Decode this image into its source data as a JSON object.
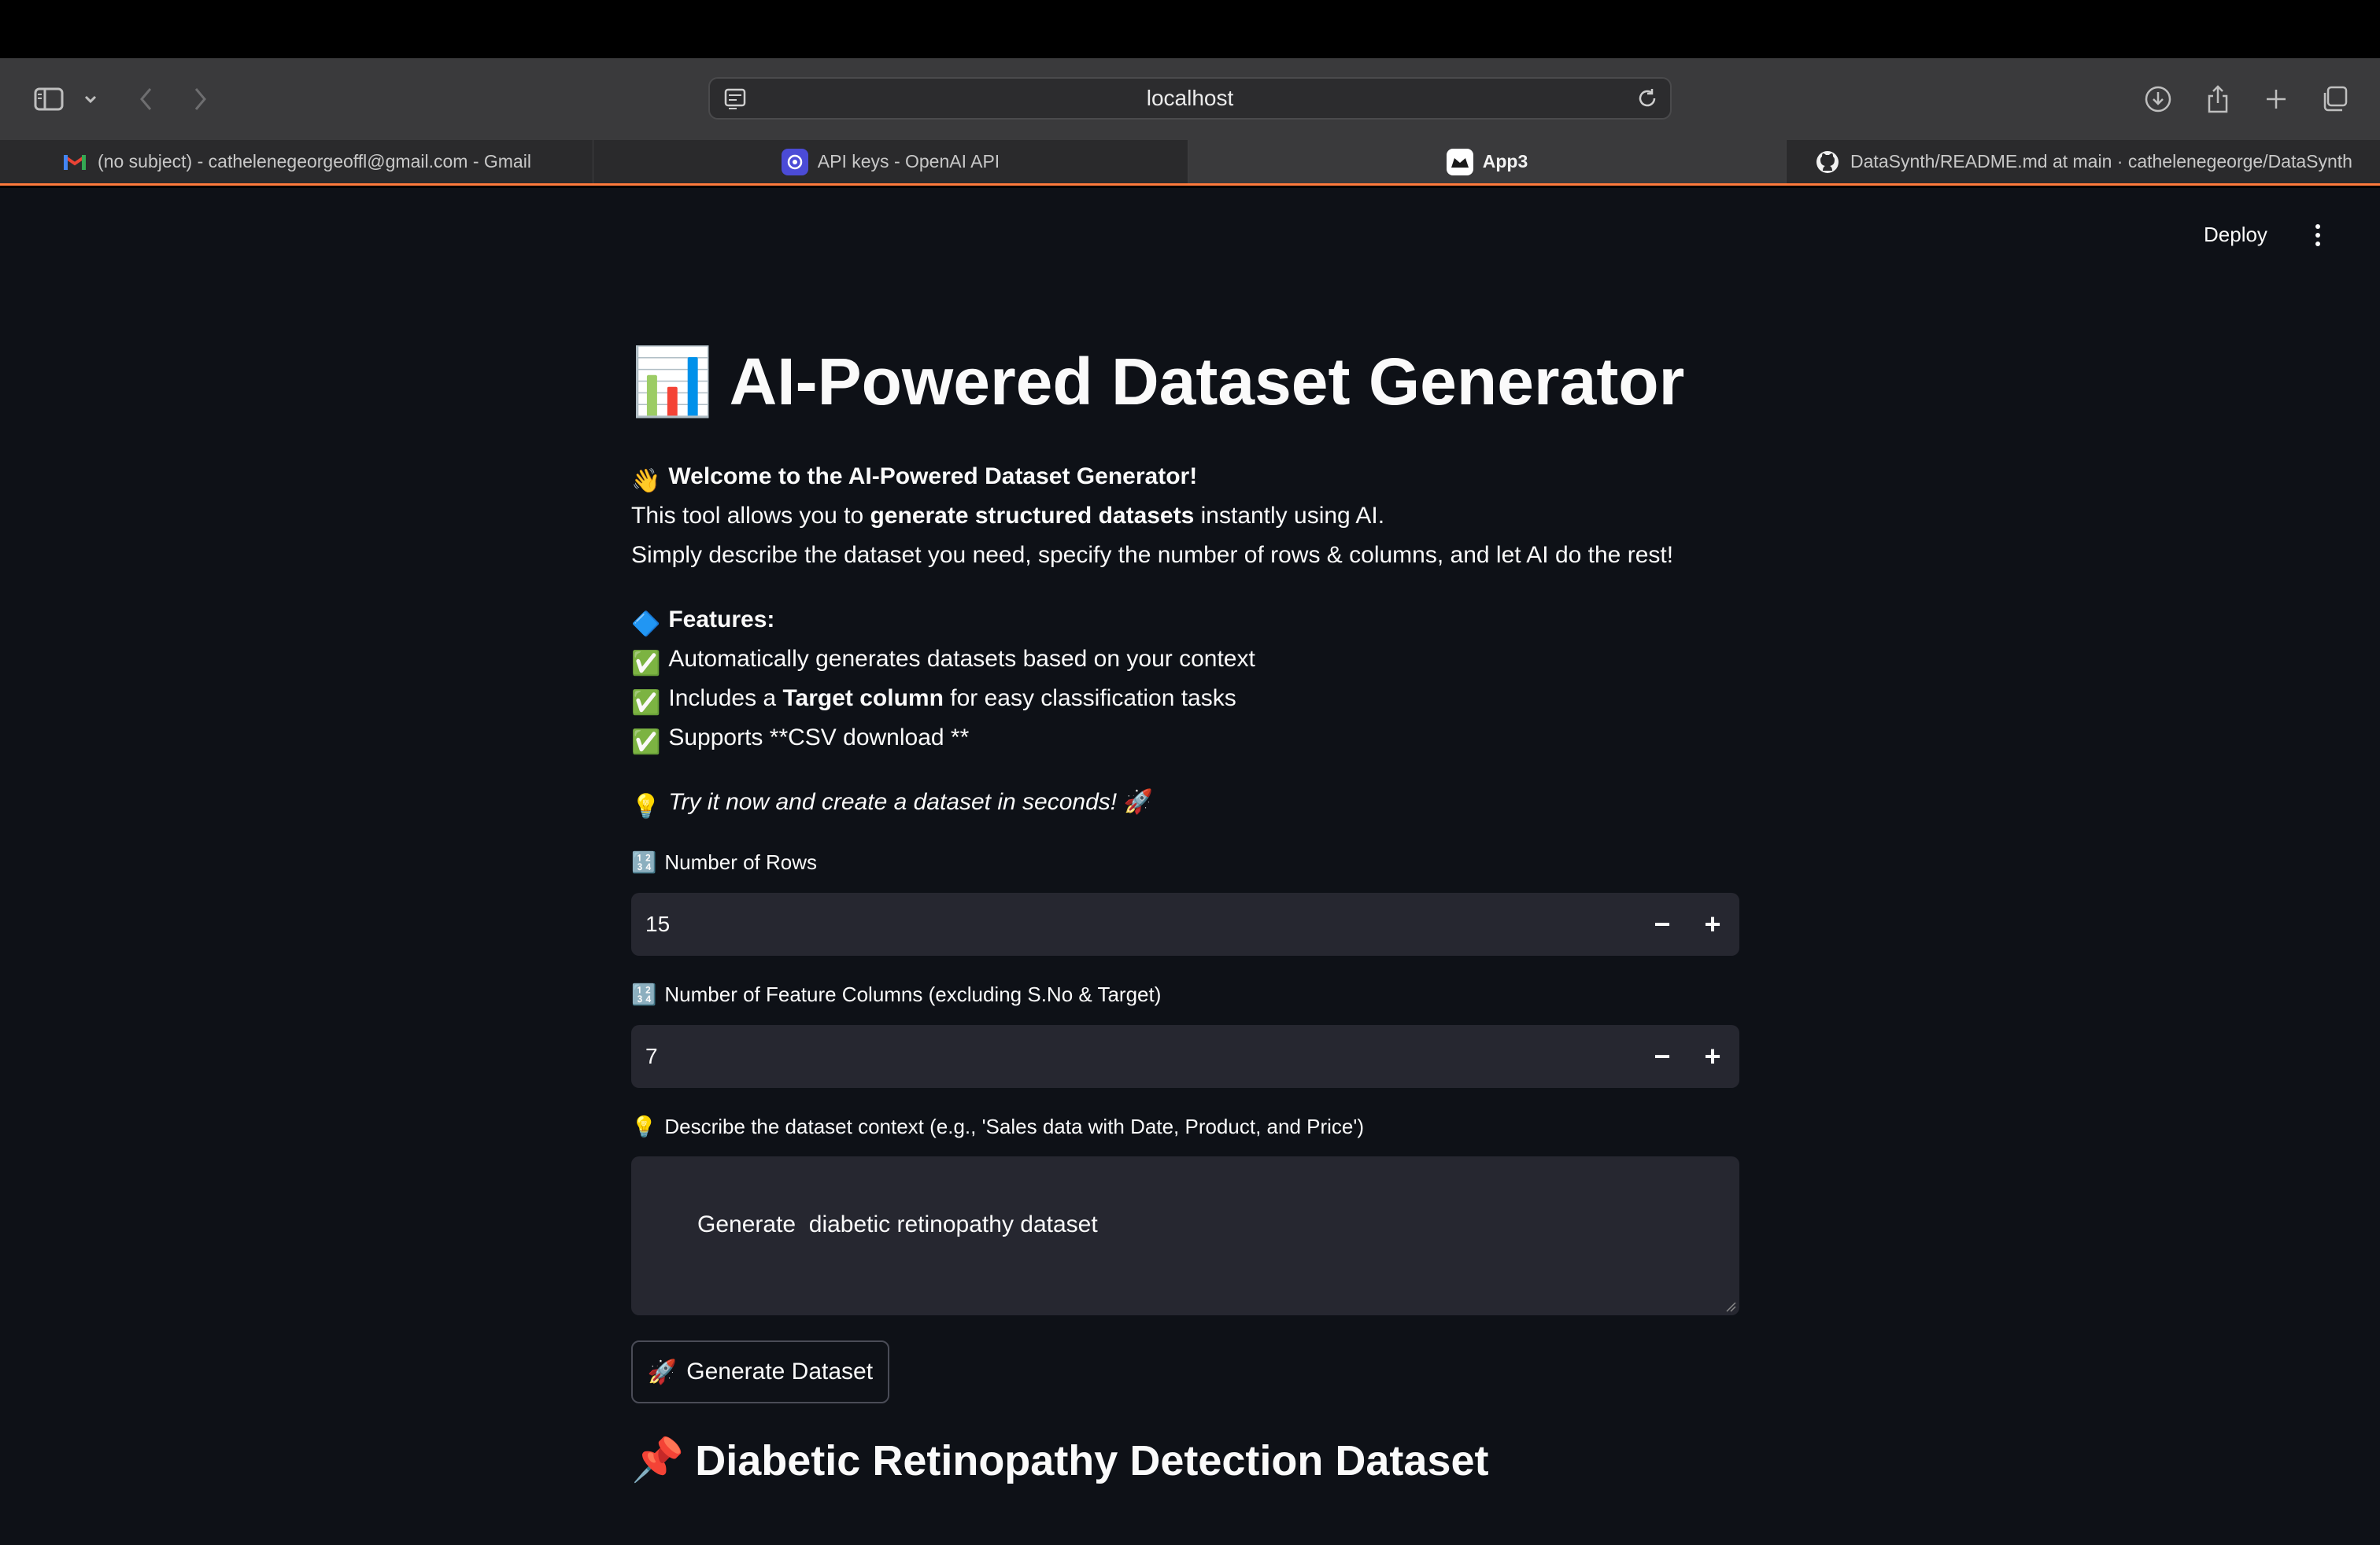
{
  "browser": {
    "url": "localhost",
    "tabs": [
      {
        "label": "(no subject) - cathelenegeorgeoffl@gmail.com - Gmail",
        "icon": "gmail-icon",
        "active": false
      },
      {
        "label": "API keys - OpenAI API",
        "icon": "openai-icon",
        "active": false
      },
      {
        "label": "App3",
        "icon": "streamlit-icon",
        "active": true
      },
      {
        "label": "DataSynth/README.md at main · cathelenegeorge/DataSynth",
        "icon": "github-icon",
        "active": false
      }
    ]
  },
  "header": {
    "deploy_label": "Deploy"
  },
  "page": {
    "title_emoji": "📊",
    "title": "AI-Powered Dataset Generator",
    "welcome_emoji": "👋",
    "welcome": "Welcome to the AI-Powered Dataset Generator!",
    "intro_pre": "This tool allows you to ",
    "intro_bold": "generate structured datasets",
    "intro_post": " instantly using AI.",
    "intro_line2": "Simply describe the dataset you need, specify the number of rows & columns, and let AI do the rest!",
    "features_emoji": "🔷",
    "features_heading": "Features:",
    "feature1": "Automatically generates datasets based on your context",
    "feature2_pre": "Includes a ",
    "feature2_bold": "Target column",
    "feature2_post": " for easy classification tasks",
    "feature3": "Supports **CSV download **",
    "check_emoji": "✅",
    "try_emoji": "💡",
    "try_text": "Try it now and create a dataset in seconds!",
    "rocket_emoji": "🚀"
  },
  "form": {
    "numbers_emoji": "🔢",
    "rows_label": "Number of Rows",
    "rows_value": "15",
    "cols_label": "Number of Feature Columns (excluding S.No & Target)",
    "cols_value": "7",
    "minus": "−",
    "plus": "+",
    "context_emoji": "💡",
    "context_label": "Describe the dataset context (e.g., 'Sales data with Date, Product, and Price')",
    "context_value": "Generate  diabetic retinopathy dataset",
    "generate_emoji": "🚀",
    "generate_label": "Generate Dataset"
  },
  "result": {
    "pin_emoji": "📌",
    "heading": "Diabetic Retinopathy Detection Dataset"
  },
  "colors": {
    "app_bg": "#0e1117",
    "input_bg": "#262730",
    "tab_accent": "#ff7a3c",
    "toolbar_bg": "#3a3a3c"
  }
}
